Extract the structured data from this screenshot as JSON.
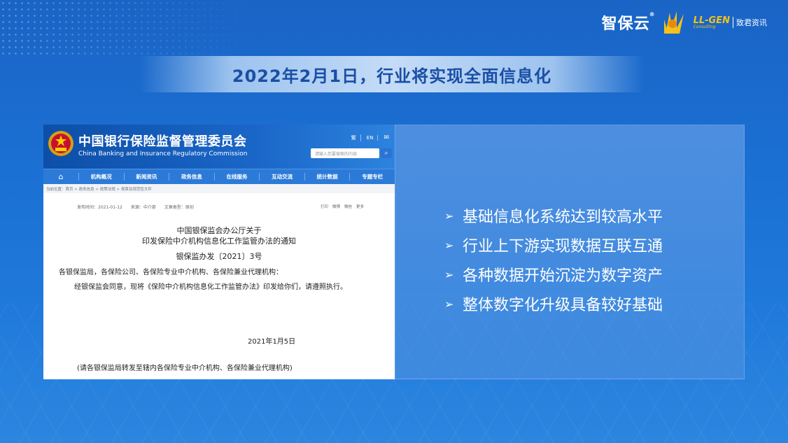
{
  "brand": {
    "zhibaoyun": "智保云",
    "registered": "®",
    "llgen_name": "LL-GEN",
    "llgen_sub": "Consulting",
    "llgen_cn": "致君资讯"
  },
  "title": "2022年2月1日，行业将实现全面信息化",
  "screenshot": {
    "org_cn": "中国银行保险监督管理委员会",
    "org_en": "China Banking and Insurance Regulatory Commission",
    "lang_trad": "繁",
    "lang_en": "EN",
    "search_placeholder": "请输入您要搜索的内容",
    "nav": [
      "机构概况",
      "新闻资讯",
      "政务信息",
      "在线服务",
      "互动交流",
      "统计数据",
      "专题专栏"
    ],
    "breadcrumb": "当前位置：首页 > 政务信息 > 政策法规 > 规章及规范性文件",
    "publish_time": "发布时间：2021-01-12",
    "source": "来源：中介部",
    "doc_type": "文章类型：原创",
    "share": [
      "打印",
      "微博",
      "微信",
      "更多"
    ],
    "doc_title_1": "中国银保监会办公厅关于",
    "doc_title_2": "印发保险中介机构信息化工作监管办法的通知",
    "doc_number": "银保监办发〔2021〕3号",
    "recipients": "各银保监局，各保险公司、各保险专业中介机构、各保险兼业代理机构：",
    "body": "经银保监会同意，现将《保险中介机构信息化工作监管办法》印发给你们，请遵照执行。",
    "date": "2021年1月5日",
    "footnote": "(请各银保监局转发至辖内各保险专业中介机构、各保险兼业代理机构)"
  },
  "bullets": [
    "基础信息化系统达到较高水平",
    "行业上下游实现数据互联互通",
    "各种数据开始沉淀为数字资产",
    "整体数字化升级具备较好基础"
  ],
  "colors": {
    "background": "#1b6fd2",
    "title_text": "#1a4fa5",
    "llgen_gold": "#f4c21a",
    "cbirc_blue": "#0d4fa8"
  }
}
